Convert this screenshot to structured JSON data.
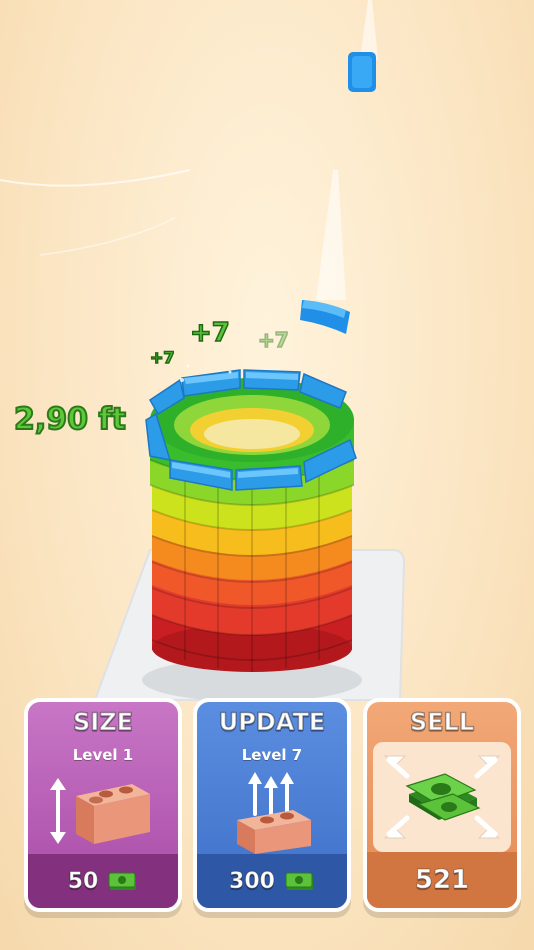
{
  "hud": {
    "height": "2,90 ft",
    "popups": [
      "+7",
      "+7",
      "+7"
    ]
  },
  "cards": {
    "size": {
      "title": "SIZE",
      "level": "Level 1",
      "price": "50",
      "icon": "brick-resize-icon"
    },
    "update": {
      "title": "UPDATE",
      "level": "Level 7",
      "price": "300",
      "icon": "brick-upgrade-icon"
    },
    "sell": {
      "title": "SELL",
      "price": "521",
      "icon": "money-stack-icon"
    }
  },
  "colors": {
    "ring_top": "#38a8f0",
    "layers": [
      "#d82a2a",
      "#f04b2a",
      "#f58a1e",
      "#f6c21a",
      "#c9e21c",
      "#6fd02a",
      "#2fb52a"
    ]
  }
}
